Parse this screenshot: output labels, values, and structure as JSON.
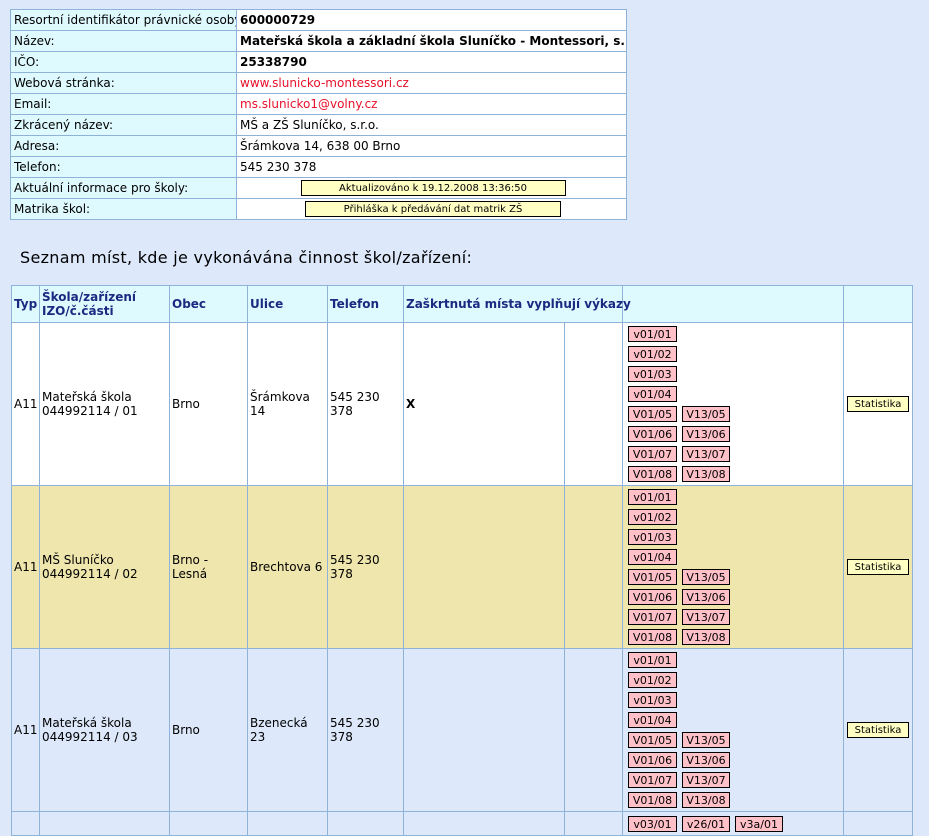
{
  "info": {
    "rows": [
      {
        "label": "Resortní identifikátor právnické osoby:",
        "value": "600000729"
      },
      {
        "label": "Název:",
        "value": "Mateřská škola a základní škola Sluníčko - Montessori, s.r.o."
      },
      {
        "label": "IČO:",
        "value": "25338790"
      },
      {
        "label": "Webová stránka:",
        "value": "www.slunicko-montessori.cz"
      },
      {
        "label": "Email:",
        "value": "ms.slunicko1@volny.cz"
      },
      {
        "label": "Zkrácený název:",
        "value": "MŠ a ZŠ Sluníčko, s.r.o."
      },
      {
        "label": "Adresa:",
        "value": "Šrámkova 14, 638 00   Brno"
      },
      {
        "label": "Telefon:",
        "value": "545 230 378"
      },
      {
        "label": "Aktuální informace pro školy:",
        "button": "Aktualizováno k 19.12.2008 13:36:50"
      },
      {
        "label": "Matrika škol:",
        "button": "Přihláška k předávání dat matrik ZŠ"
      }
    ]
  },
  "section_title": "Seznam míst, kde je vykonávána činnost škol/zařízení:",
  "sites": {
    "headers": {
      "typ": "Typ",
      "skola_line1": "Škola/zařízení",
      "skola_line2": "IZO/č.části",
      "obec": "Obec",
      "ulice": "Ulice",
      "telefon": "Telefon",
      "zaskrt": "Zaškrtnutá místa vyplňují výkazy"
    },
    "stat_label": "Statistika",
    "rows": [
      {
        "typ": "A11",
        "name": "Mateřská škola",
        "izo": "044992114 / 01",
        "obec": "Brno",
        "ulice": "Šrámkova 14",
        "telefon": "545 230 378",
        "mark": "X",
        "forms": [
          [
            "v01/01"
          ],
          [
            "v01/02"
          ],
          [
            "v01/03"
          ],
          [
            "v01/04"
          ],
          [
            "V01/05",
            "V13/05"
          ],
          [
            "V01/06",
            "V13/06"
          ],
          [
            "V01/07",
            "V13/07"
          ],
          [
            "V01/08",
            "V13/08"
          ]
        ]
      },
      {
        "typ": "A11",
        "name": "MŠ Sluníčko",
        "izo": "044992114 / 02",
        "obec": "Brno - Lesná",
        "ulice": "Brechtova 6",
        "telefon": "545 230 378",
        "mark": "",
        "forms": [
          [
            "v01/01"
          ],
          [
            "v01/02"
          ],
          [
            "v01/03"
          ],
          [
            "v01/04"
          ],
          [
            "V01/05",
            "V13/05"
          ],
          [
            "V01/06",
            "V13/06"
          ],
          [
            "V01/07",
            "V13/07"
          ],
          [
            "V01/08",
            "V13/08"
          ]
        ]
      },
      {
        "typ": "A11",
        "name": "Mateřská škola",
        "izo": "044992114 / 03",
        "obec": "Brno",
        "ulice": "Bzenecká 23",
        "telefon": "545 230 378",
        "mark": "",
        "forms": [
          [
            "v01/01"
          ],
          [
            "v01/02"
          ],
          [
            "v01/03"
          ],
          [
            "v01/04"
          ],
          [
            "V01/05",
            "V13/05"
          ],
          [
            "V01/06",
            "V13/06"
          ],
          [
            "V01/07",
            "V13/07"
          ],
          [
            "V01/08",
            "V13/08"
          ]
        ]
      }
    ],
    "stub_forms": [
      "v03/01",
      "v26/01",
      "v3a/01"
    ]
  }
}
